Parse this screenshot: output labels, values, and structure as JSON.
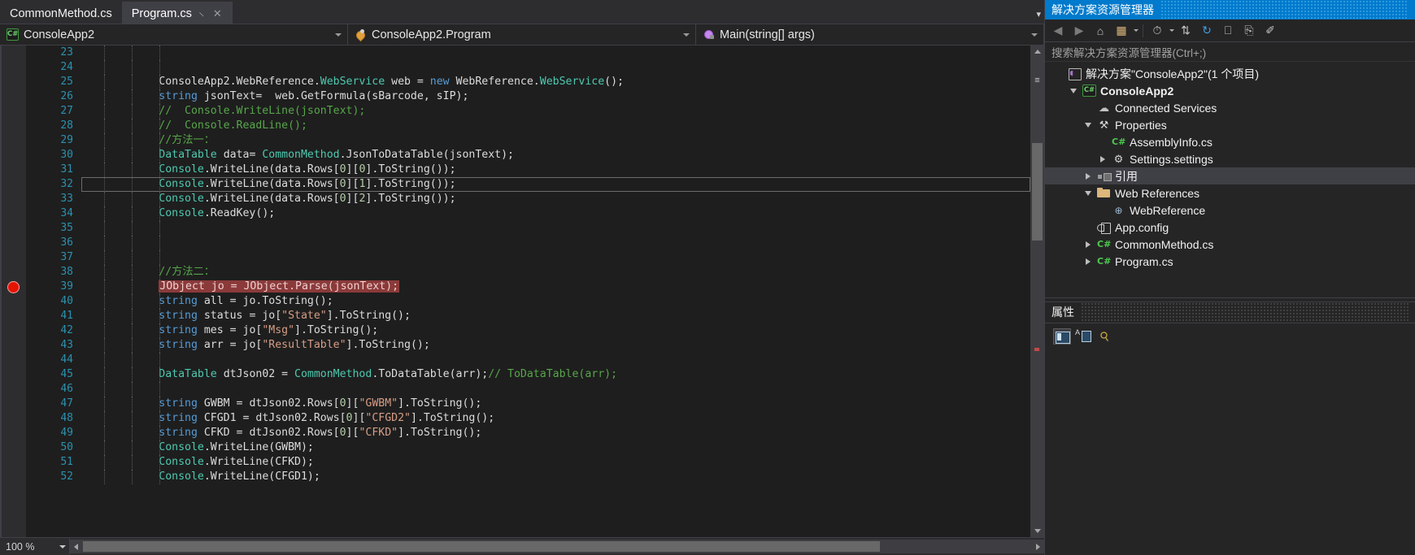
{
  "window": {
    "zoom_level": "100 %"
  },
  "tabs": [
    {
      "label": "CommonMethod.cs",
      "active": false,
      "pinned": false,
      "closeable": false
    },
    {
      "label": "Program.cs",
      "active": true,
      "pinned": true,
      "closeable": true
    }
  ],
  "tabstrip": {
    "overflow_caret": "▾",
    "pin_glyph": "–",
    "close_glyph": "✕"
  },
  "navbar": {
    "project": {
      "label": "ConsoleApp2",
      "icon": "csharp-project-icon"
    },
    "type": {
      "label": "ConsoleApp2.Program",
      "icon": "class-icon"
    },
    "member": {
      "label": "Main(string[] args)",
      "icon": "method-icon"
    }
  },
  "editor": {
    "first_line": 23,
    "breakpoint_line": 39,
    "current_line": 31,
    "lines": [
      {
        "n": 23,
        "tokens": []
      },
      {
        "n": 24,
        "tokens": []
      },
      {
        "n": 25,
        "tokens": [
          {
            "t": "            ",
            "c": "plain"
          },
          {
            "t": "ConsoleApp2.WebReference.",
            "c": "plain"
          },
          {
            "t": "WebService",
            "c": "type"
          },
          {
            "t": " web = ",
            "c": "plain"
          },
          {
            "t": "new",
            "c": "key"
          },
          {
            "t": " WebReference.",
            "c": "plain"
          },
          {
            "t": "WebService",
            "c": "type"
          },
          {
            "t": "();",
            "c": "plain"
          }
        ]
      },
      {
        "n": 26,
        "tokens": [
          {
            "t": "            ",
            "c": "plain"
          },
          {
            "t": "string",
            "c": "key"
          },
          {
            "t": " jsonText=  web.GetFormula(sBarcode, sIP);",
            "c": "plain"
          }
        ]
      },
      {
        "n": 27,
        "tokens": [
          {
            "t": "            //  Console.WriteLine(jsonText);",
            "c": "comment"
          }
        ]
      },
      {
        "n": 28,
        "tokens": [
          {
            "t": "            //  Console.ReadLine();",
            "c": "comment"
          }
        ]
      },
      {
        "n": 29,
        "tokens": [
          {
            "t": "            //方法一：",
            "c": "comment"
          }
        ]
      },
      {
        "n": 30,
        "tokens": [
          {
            "t": "            ",
            "c": "plain"
          },
          {
            "t": "DataTable",
            "c": "type"
          },
          {
            "t": " data= ",
            "c": "plain"
          },
          {
            "t": "CommonMethod",
            "c": "type"
          },
          {
            "t": ".JsonToDataTable(jsonText);",
            "c": "plain"
          }
        ]
      },
      {
        "n": 31,
        "tokens": [
          {
            "t": "            ",
            "c": "plain"
          },
          {
            "t": "Console",
            "c": "type"
          },
          {
            "t": ".WriteLine(data.Rows[",
            "c": "plain"
          },
          {
            "t": "0",
            "c": "num"
          },
          {
            "t": "][",
            "c": "plain"
          },
          {
            "t": "0",
            "c": "num"
          },
          {
            "t": "].ToString());",
            "c": "plain"
          }
        ]
      },
      {
        "n": 32,
        "tokens": [
          {
            "t": "            ",
            "c": "plain"
          },
          {
            "t": "Console",
            "c": "type"
          },
          {
            "t": ".WriteLine(data.Rows[",
            "c": "plain"
          },
          {
            "t": "0",
            "c": "num"
          },
          {
            "t": "][",
            "c": "plain"
          },
          {
            "t": "1",
            "c": "num"
          },
          {
            "t": "].ToString());",
            "c": "plain"
          }
        ]
      },
      {
        "n": 33,
        "tokens": [
          {
            "t": "            ",
            "c": "plain"
          },
          {
            "t": "Console",
            "c": "type"
          },
          {
            "t": ".WriteLine(data.Rows[",
            "c": "plain"
          },
          {
            "t": "0",
            "c": "num"
          },
          {
            "t": "][",
            "c": "plain"
          },
          {
            "t": "2",
            "c": "num"
          },
          {
            "t": "].ToString());",
            "c": "plain"
          }
        ]
      },
      {
        "n": 34,
        "tokens": [
          {
            "t": "            ",
            "c": "plain"
          },
          {
            "t": "Console",
            "c": "type"
          },
          {
            "t": ".ReadKey();",
            "c": "plain"
          }
        ]
      },
      {
        "n": 35,
        "tokens": []
      },
      {
        "n": 36,
        "tokens": []
      },
      {
        "n": 37,
        "tokens": []
      },
      {
        "n": 38,
        "tokens": [
          {
            "t": "            //方法二：",
            "c": "comment"
          }
        ]
      },
      {
        "n": 39,
        "highlight": true,
        "tokens": [
          {
            "t": "            ",
            "c": "plain"
          },
          {
            "t": "JObject jo = JObject.Parse(jsonText);",
            "c": "hl"
          }
        ]
      },
      {
        "n": 40,
        "tokens": [
          {
            "t": "            ",
            "c": "plain"
          },
          {
            "t": "string",
            "c": "key"
          },
          {
            "t": " all = jo.ToString();",
            "c": "plain"
          }
        ]
      },
      {
        "n": 41,
        "tokens": [
          {
            "t": "            ",
            "c": "plain"
          },
          {
            "t": "string",
            "c": "key"
          },
          {
            "t": " status = jo[",
            "c": "plain"
          },
          {
            "t": "\"State\"",
            "c": "string"
          },
          {
            "t": "].ToString();",
            "c": "plain"
          }
        ]
      },
      {
        "n": 42,
        "tokens": [
          {
            "t": "            ",
            "c": "plain"
          },
          {
            "t": "string",
            "c": "key"
          },
          {
            "t": " mes = jo[",
            "c": "plain"
          },
          {
            "t": "\"Msg\"",
            "c": "string"
          },
          {
            "t": "].ToString();",
            "c": "plain"
          }
        ]
      },
      {
        "n": 43,
        "tokens": [
          {
            "t": "            ",
            "c": "plain"
          },
          {
            "t": "string",
            "c": "key"
          },
          {
            "t": " arr = jo[",
            "c": "plain"
          },
          {
            "t": "\"ResultTable\"",
            "c": "string"
          },
          {
            "t": "].ToString();",
            "c": "plain"
          }
        ]
      },
      {
        "n": 44,
        "tokens": []
      },
      {
        "n": 45,
        "tokens": [
          {
            "t": "            ",
            "c": "plain"
          },
          {
            "t": "DataTable",
            "c": "type"
          },
          {
            "t": " dtJson02 = ",
            "c": "plain"
          },
          {
            "t": "CommonMethod",
            "c": "type"
          },
          {
            "t": ".ToDataTable(arr);",
            "c": "plain"
          },
          {
            "t": "// ToDataTable(arr);",
            "c": "comment"
          }
        ]
      },
      {
        "n": 46,
        "tokens": []
      },
      {
        "n": 47,
        "tokens": [
          {
            "t": "            ",
            "c": "plain"
          },
          {
            "t": "string",
            "c": "key"
          },
          {
            "t": " GWBM = dtJson02.Rows[",
            "c": "plain"
          },
          {
            "t": "0",
            "c": "num"
          },
          {
            "t": "][",
            "c": "plain"
          },
          {
            "t": "\"GWBM\"",
            "c": "string"
          },
          {
            "t": "].ToString();",
            "c": "plain"
          }
        ]
      },
      {
        "n": 48,
        "tokens": [
          {
            "t": "            ",
            "c": "plain"
          },
          {
            "t": "string",
            "c": "key"
          },
          {
            "t": " CFGD1 = dtJson02.Rows[",
            "c": "plain"
          },
          {
            "t": "0",
            "c": "num"
          },
          {
            "t": "][",
            "c": "plain"
          },
          {
            "t": "\"CFGD2\"",
            "c": "string"
          },
          {
            "t": "].ToString();",
            "c": "plain"
          }
        ]
      },
      {
        "n": 49,
        "tokens": [
          {
            "t": "            ",
            "c": "plain"
          },
          {
            "t": "string",
            "c": "key"
          },
          {
            "t": " CFKD = dtJson02.Rows[",
            "c": "plain"
          },
          {
            "t": "0",
            "c": "num"
          },
          {
            "t": "][",
            "c": "plain"
          },
          {
            "t": "\"CFKD\"",
            "c": "string"
          },
          {
            "t": "].ToString();",
            "c": "plain"
          }
        ]
      },
      {
        "n": 50,
        "tokens": [
          {
            "t": "            ",
            "c": "plain"
          },
          {
            "t": "Console",
            "c": "type"
          },
          {
            "t": ".WriteLine(GWBM);",
            "c": "plain"
          }
        ]
      },
      {
        "n": 51,
        "tokens": [
          {
            "t": "            ",
            "c": "plain"
          },
          {
            "t": "Console",
            "c": "type"
          },
          {
            "t": ".WriteLine(CFKD);",
            "c": "plain"
          }
        ]
      },
      {
        "n": 52,
        "tokens": [
          {
            "t": "            ",
            "c": "plain"
          },
          {
            "t": "Console",
            "c": "type"
          },
          {
            "t": ".WriteLine(CFGD1);",
            "c": "plain"
          }
        ]
      }
    ]
  },
  "solution_explorer": {
    "title": "解决方案资源管理器",
    "search_placeholder": "搜索解决方案资源管理器(Ctrl+;)",
    "toolbar": [
      {
        "name": "back-icon",
        "glyph": "←"
      },
      {
        "name": "forward-icon",
        "glyph": "→"
      },
      {
        "name": "home-icon",
        "glyph": "⌂"
      },
      {
        "name": "show-all-files-icon",
        "glyph": "▣"
      },
      {
        "name": "pending-changes-icon",
        "glyph": "◴"
      },
      {
        "name": "sync-with-active-document-icon",
        "glyph": "⇅"
      },
      {
        "name": "refresh-icon",
        "glyph": "↻"
      },
      {
        "name": "collapse-all-icon",
        "glyph": "❐"
      },
      {
        "name": "properties-window-icon",
        "glyph": "⎘"
      },
      {
        "name": "view-code-icon",
        "glyph": "✐"
      }
    ],
    "tree": [
      {
        "label": "解决方案\"ConsoleApp2\"(1 个项目)",
        "indent": 0,
        "twist": "none",
        "icon": "solution-icon",
        "bold": false,
        "selected": false
      },
      {
        "label": "ConsoleApp2",
        "indent": 1,
        "twist": "open",
        "icon": "csharp-project-icon",
        "bold": true,
        "selected": false
      },
      {
        "label": "Connected Services",
        "indent": 2,
        "twist": "none",
        "icon": "connected-services-icon",
        "bold": false,
        "selected": false
      },
      {
        "label": "Properties",
        "indent": 2,
        "twist": "open",
        "icon": "wrench-icon",
        "bold": false,
        "selected": false
      },
      {
        "label": "AssemblyInfo.cs",
        "indent": 3,
        "twist": "none",
        "icon": "csharp-file-icon",
        "bold": false,
        "selected": false
      },
      {
        "label": "Settings.settings",
        "indent": 3,
        "twist": "closed",
        "icon": "gear-icon",
        "bold": false,
        "selected": false
      },
      {
        "label": "引用",
        "indent": 2,
        "twist": "closed",
        "icon": "references-icon",
        "bold": false,
        "selected": true
      },
      {
        "label": "Web References",
        "indent": 2,
        "twist": "open",
        "icon": "folder-icon",
        "bold": false,
        "selected": false
      },
      {
        "label": "WebReference",
        "indent": 3,
        "twist": "none",
        "icon": "web-reference-icon",
        "bold": false,
        "selected": false
      },
      {
        "label": "App.config",
        "indent": 2,
        "twist": "none",
        "icon": "config-file-icon",
        "bold": false,
        "selected": false
      },
      {
        "label": "CommonMethod.cs",
        "indent": 2,
        "twist": "closed",
        "icon": "csharp-file-icon",
        "bold": false,
        "selected": false
      },
      {
        "label": "Program.cs",
        "indent": 2,
        "twist": "closed",
        "icon": "csharp-file-icon",
        "bold": false,
        "selected": false
      }
    ]
  },
  "properties_panel": {
    "title": "属性",
    "toolbar": [
      {
        "name": "categorized-view-icon",
        "selected": true
      },
      {
        "name": "alphabetical-view-icon",
        "selected": false
      },
      {
        "name": "properties-icon",
        "selected": false
      }
    ]
  },
  "colors": {
    "accent": "#007acc",
    "editor_bg": "#1e1e1e",
    "panel_bg": "#252526",
    "chrome_bg": "#2d2d30",
    "breakpoint": "#e51400",
    "highlight_red": "#8b3a3a",
    "linenum": "#2b91af",
    "comment": "#57a64a",
    "keyword": "#569cd6",
    "type": "#4ec9b0",
    "string": "#d69d85"
  }
}
